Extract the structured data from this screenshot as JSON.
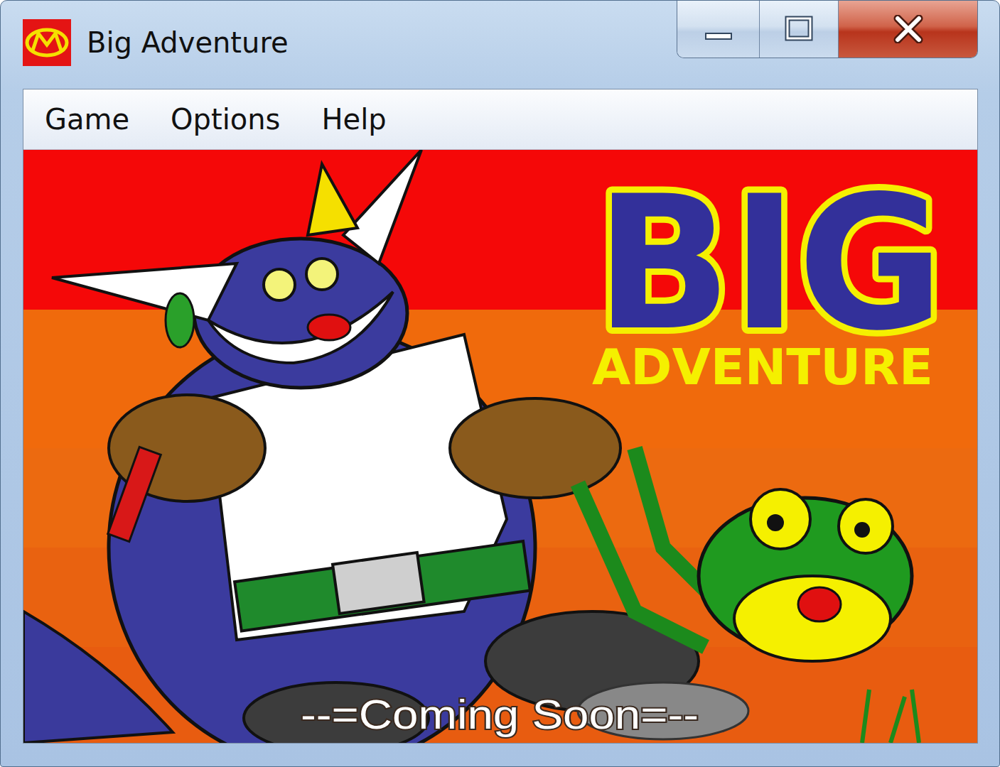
{
  "window": {
    "title": "Big Adventure"
  },
  "menu": [
    {
      "label": "Game"
    },
    {
      "label": "Options"
    },
    {
      "label": "Help"
    }
  ],
  "splash": {
    "logo": "BIG",
    "subtitle": "ADVENTURE",
    "caption": "--=Coming Soon=--"
  }
}
